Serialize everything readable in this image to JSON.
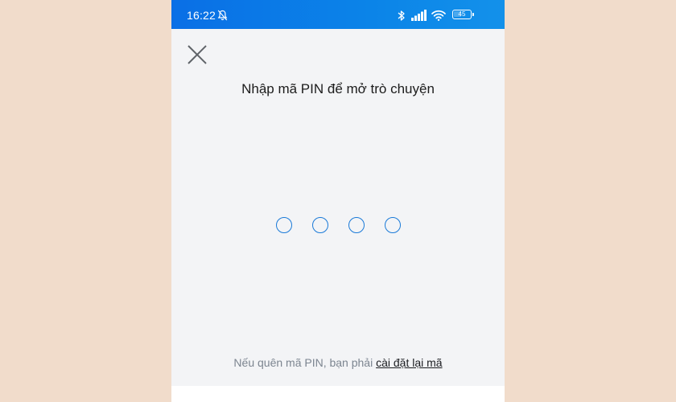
{
  "status_bar": {
    "time": "16:22",
    "battery_level": "45",
    "icons": [
      "bell-off-icon",
      "bluetooth-icon",
      "signal-icon",
      "wifi-icon",
      "battery-icon"
    ]
  },
  "colors": {
    "status_bar": "#0b84e8",
    "background": "#f3f4f6",
    "pin_dot_border": "#1a7ad8",
    "outer_background": "#f1dccb"
  },
  "header": {
    "close_icon": "close-icon",
    "title": "Nhập mã PIN để mở trò chuyện"
  },
  "pin": {
    "length": 4,
    "filled": 0
  },
  "footer": {
    "text": "Nếu quên mã PIN, bạn phải ",
    "link_label": "cài đặt lại mã"
  }
}
